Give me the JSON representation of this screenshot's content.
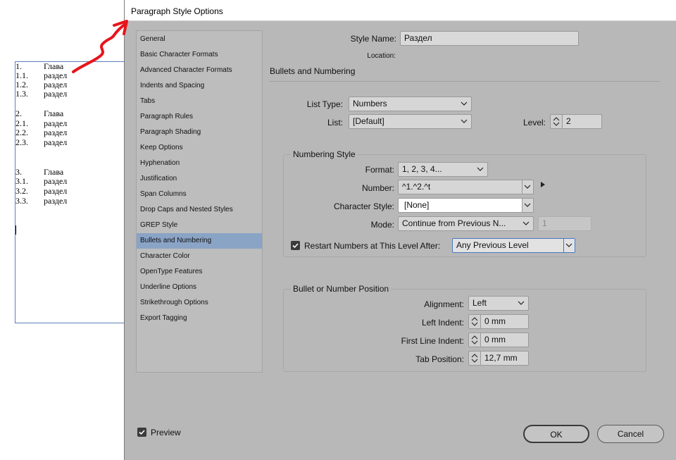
{
  "document": {
    "lines": [
      {
        "num": "1.",
        "text": "Глава"
      },
      {
        "num": "1.1.",
        "text": "раздел"
      },
      {
        "num": "1.2.",
        "text": "раздел"
      },
      {
        "num": "1.3.",
        "text": "раздел"
      },
      {
        "num": "2.",
        "text": "Глава"
      },
      {
        "num": "2.1.",
        "text": "раздел"
      },
      {
        "num": "2.2.",
        "text": "раздел"
      },
      {
        "num": "2.3.",
        "text": "раздел"
      },
      {
        "num": "3.",
        "text": "Глава"
      },
      {
        "num": "3.1.",
        "text": "раздел"
      },
      {
        "num": "3.2.",
        "text": "раздел"
      },
      {
        "num": "3.3.",
        "text": "раздел"
      }
    ]
  },
  "dialog": {
    "title": "Paragraph Style Options",
    "categories": [
      "General",
      "Basic Character Formats",
      "Advanced Character Formats",
      "Indents and Spacing",
      "Tabs",
      "Paragraph Rules",
      "Paragraph Shading",
      "Keep Options",
      "Hyphenation",
      "Justification",
      "Span Columns",
      "Drop Caps and Nested Styles",
      "GREP Style",
      "Bullets and Numbering",
      "Character Color",
      "OpenType Features",
      "Underline Options",
      "Strikethrough Options",
      "Export Tagging"
    ],
    "selected_category": "Bullets and Numbering",
    "style_name_label": "Style Name:",
    "style_name_value": "Раздел",
    "location_label": "Location:",
    "section_title": "Bullets and Numbering",
    "list_type_label": "List Type:",
    "list_type_value": "Numbers",
    "list_label": "List:",
    "list_value": "[Default]",
    "level_label": "Level:",
    "level_value": "2",
    "numbering_style": {
      "title": "Numbering Style",
      "format_label": "Format:",
      "format_value": "1, 2, 3, 4...",
      "number_label": "Number:",
      "number_value": "^1.^2.^t",
      "char_style_label": "Character Style:",
      "char_style_value": "[None]",
      "mode_label": "Mode:",
      "mode_value": "Continue from Previous N...",
      "mode_start_value": "1",
      "restart_label": "Restart Numbers at This Level After:",
      "restart_checked": true,
      "restart_value": "Any Previous Level"
    },
    "position": {
      "title": "Bullet or Number Position",
      "alignment_label": "Alignment:",
      "alignment_value": "Left",
      "left_indent_label": "Left Indent:",
      "left_indent_value": "0 mm",
      "first_line_label": "First Line Indent:",
      "first_line_value": "0 mm",
      "tab_position_label": "Tab Position:",
      "tab_position_value": "12,7 mm"
    },
    "preview_label": "Preview",
    "preview_checked": true,
    "ok_label": "OK",
    "cancel_label": "Cancel"
  },
  "colors": {
    "dialog_bg": "#b8b8b8",
    "selected_category": "#8aa4c6",
    "annotation_arrow": "#e8141b"
  }
}
